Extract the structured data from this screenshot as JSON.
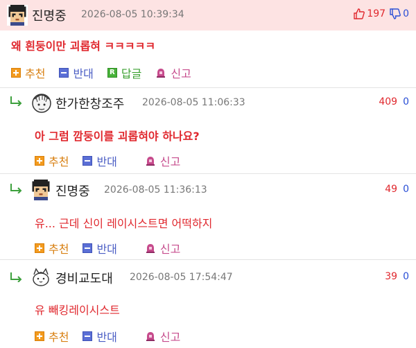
{
  "comments": [
    {
      "nick": "진명중",
      "date": "2026-08-05 10:39:34",
      "up": "197",
      "down": "0",
      "text": "왜 흰둥이만 괴롭혀 ㅋㅋㅋㅋㅋ",
      "actions": {
        "recommend": "추천",
        "oppose": "반대",
        "reply": "답글",
        "report": "신고"
      }
    },
    {
      "nick": "한가한창조주",
      "date": "2026-08-05 11:06:33",
      "up": "409",
      "down": "0",
      "text": "아 그럼 깜둥이를 괴롭혀야 하나요?",
      "actions": {
        "recommend": "추천",
        "oppose": "반대",
        "report": "신고"
      }
    },
    {
      "nick": "진명중",
      "date": "2026-08-05 11:36:13",
      "up": "49",
      "down": "0",
      "text": "유... 근데 신이 레이시스트면 어떡하지",
      "actions": {
        "recommend": "추천",
        "oppose": "반대",
        "report": "신고"
      }
    },
    {
      "nick": "경비교도대",
      "date": "2026-08-05 17:54:47",
      "up": "39",
      "down": "0",
      "text": "유 빼킹레이시스트",
      "actions": {
        "recommend": "추천",
        "oppose": "반대",
        "report": "신고"
      }
    }
  ],
  "reply_badge_letter": "R",
  "colors": {
    "header_bg": "#fde3e3",
    "up": "#e0282e",
    "down": "#2a4fd6",
    "text_red": "#e0282e"
  },
  "icons": [
    "thumbs-up-icon",
    "thumbs-down-icon",
    "recommend-icon",
    "oppose-icon",
    "reply-icon",
    "report-icon",
    "reply-arrow-icon",
    "avatar"
  ]
}
